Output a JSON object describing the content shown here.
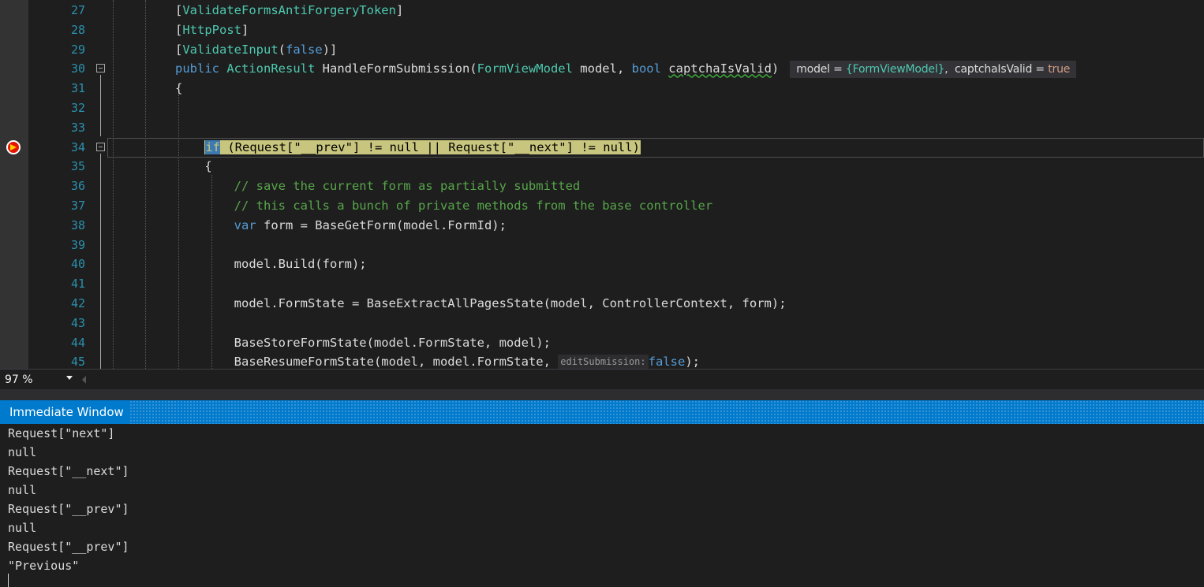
{
  "editor": {
    "lines": [
      {
        "num": "27",
        "segments": [
          {
            "t": "[",
            "c": "id"
          },
          {
            "t": "ValidateFormsAntiForgeryToken",
            "c": "ty"
          },
          {
            "t": "]",
            "c": "id"
          }
        ]
      },
      {
        "num": "28",
        "segments": [
          {
            "t": "[",
            "c": "id"
          },
          {
            "t": "HttpPost",
            "c": "ty"
          },
          {
            "t": "]",
            "c": "id"
          }
        ]
      },
      {
        "num": "29",
        "segments": [
          {
            "t": "[",
            "c": "id"
          },
          {
            "t": "ValidateInput",
            "c": "ty"
          },
          {
            "t": "(",
            "c": "id"
          },
          {
            "t": "false",
            "c": "kw"
          },
          {
            "t": ")]",
            "c": "id"
          }
        ]
      },
      {
        "num": "30",
        "segments": [
          {
            "t": "public ",
            "c": "kw"
          },
          {
            "t": "ActionResult ",
            "c": "ty"
          },
          {
            "t": "HandleFormSubmission(",
            "c": "id"
          },
          {
            "t": "FormViewModel ",
            "c": "ty"
          },
          {
            "t": "model, ",
            "c": "id"
          },
          {
            "t": "bool ",
            "c": "kw"
          },
          {
            "t": "captchaIsValid",
            "c": "id squig"
          },
          {
            "t": ")",
            "c": "id"
          }
        ]
      },
      {
        "num": "31",
        "segments": [
          {
            "t": "{",
            "c": "id"
          }
        ]
      },
      {
        "num": "32",
        "segments": []
      },
      {
        "num": "33",
        "segments": []
      },
      {
        "num": "34",
        "segments": [
          {
            "t": "    ",
            "c": "id"
          }
        ]
      },
      {
        "num": "35",
        "segments": [
          {
            "t": "    {",
            "c": "id"
          }
        ]
      },
      {
        "num": "36",
        "segments": [
          {
            "t": "        // save the current form as partially submitted",
            "c": "cm"
          }
        ]
      },
      {
        "num": "37",
        "segments": [
          {
            "t": "        // this calls a bunch of private methods from the base controller",
            "c": "cm"
          }
        ]
      },
      {
        "num": "38",
        "segments": [
          {
            "t": "        ",
            "c": "id"
          },
          {
            "t": "var ",
            "c": "kw"
          },
          {
            "t": "form = BaseGetForm(model.FormId);",
            "c": "id"
          }
        ]
      },
      {
        "num": "39",
        "segments": []
      },
      {
        "num": "40",
        "segments": [
          {
            "t": "        model.Build(form);",
            "c": "id"
          }
        ]
      },
      {
        "num": "41",
        "segments": []
      },
      {
        "num": "42",
        "segments": [
          {
            "t": "        model.FormState = BaseExtractAllPagesState(model, ControllerContext, form);",
            "c": "id"
          }
        ]
      },
      {
        "num": "43",
        "segments": []
      },
      {
        "num": "44",
        "segments": [
          {
            "t": "        BaseStoreFormState(model.FormState, model);",
            "c": "id"
          }
        ]
      },
      {
        "num": "45",
        "segments": [
          {
            "t": "        BaseResumeFormState(model, model.FormState, ",
            "c": "id"
          }
        ]
      }
    ],
    "exec_line": {
      "selected": "if",
      "rest": " (Request[\"__prev\"] != null || Request[\"__next\"] != null)"
    },
    "datatip": {
      "model_label": "model = ",
      "model_value": "{FormViewModel}",
      "sep": ",  ",
      "captcha_label": "captchaIsValid = ",
      "captcha_value": "true"
    },
    "param_hint": {
      "name": "editSubmission:",
      "value": "false",
      "tail": ");"
    }
  },
  "statusbar": {
    "zoom": "97 %"
  },
  "immediate_window": {
    "title": "Immediate Window",
    "lines": [
      "Request[\"next\"]",
      "null",
      "Request[\"__next\"]",
      "null",
      "Request[\"__prev\"]",
      "null",
      "Request[\"__prev\"]",
      "\"Previous\""
    ]
  }
}
